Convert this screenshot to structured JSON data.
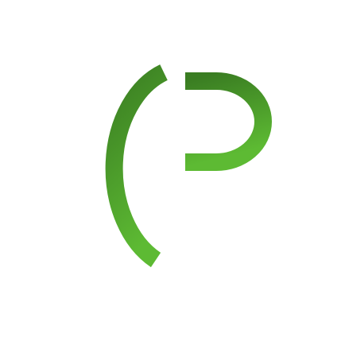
{
  "logo": {
    "name": "gp-monogram-logo",
    "text": "GP",
    "colors": {
      "background": "#ffffff",
      "gradient_top": "#3a7d22",
      "gradient_bottom": "#5dba33"
    }
  }
}
